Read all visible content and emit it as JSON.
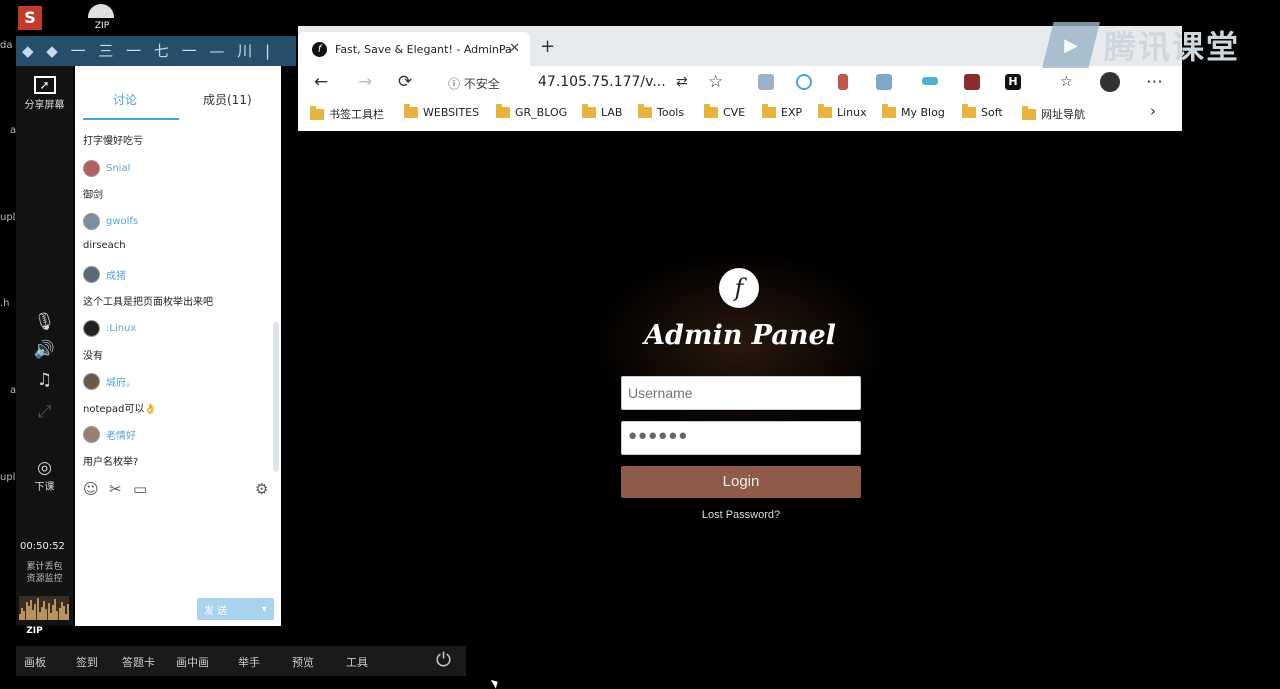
{
  "desktop": {
    "zip_label": "ZIP",
    "left_edge": [
      "da",
      "a",
      "upl",
      ".h",
      "a",
      "upl"
    ]
  },
  "classroom": {
    "header_text": "◆ ◆ 一 三 一 七 一 — 川 |",
    "toolbar": {
      "share_screen": "分享屏幕",
      "end_class": "下课",
      "elapsed_time": "00:50:52",
      "stat_label": "累计丢包",
      "monitor_label": "资源监控",
      "zip_label": "ZIP"
    },
    "chat": {
      "tab_discuss": "讨论",
      "tab_members": "成员(11)",
      "messages": [
        {
          "name": "",
          "text": "打字慢好吃亏"
        },
        {
          "name": "Snial",
          "text": "御剑"
        },
        {
          "name": "gwolfs",
          "text": "dirseach"
        },
        {
          "name": "成猪",
          "text": "这个工具是把页面枚举出来吧"
        },
        {
          "name": ":Linux",
          "text": "没有"
        },
        {
          "name": "城府。",
          "text": "notepad可以👌"
        },
        {
          "name": "老情好",
          "text": "用户名枚举?"
        }
      ],
      "send_label": "发 送",
      "send_arrow": "▾"
    },
    "bottom_bar": [
      "画板",
      "签到",
      "答题卡",
      "画中画",
      "举手",
      "预览",
      "工具"
    ]
  },
  "browser": {
    "tab_title": "Fast, Save & Elegant! - AdminPa",
    "favicon": "f",
    "close": "✕",
    "new_tab": "+",
    "back": "←",
    "forward": "→",
    "reload": "⟳",
    "security_warning": "ⓘ 不安全",
    "url": "47.105.75.177/v...",
    "star": "☆",
    "menu": "⋯",
    "bookmarks": [
      "书签工具栏",
      "WEBSITES",
      "GR_BLOG",
      "LAB",
      "Tools",
      "CVE",
      "EXP",
      "Linux",
      "My Blog",
      "Soft",
      "网址导航"
    ],
    "bookmarks_more": "›"
  },
  "watermark": {
    "text": "腾讯课堂"
  },
  "admin": {
    "logo": "f",
    "title": "Admin Panel",
    "username_placeholder": "Username",
    "password_mask": "●●●●●●",
    "login_label": "Login",
    "lost_password": "Lost Password?"
  },
  "colors": {
    "accent_blue": "#4aa3d8",
    "login_button": "#8e5a49",
    "folder": "#e6b33f"
  }
}
